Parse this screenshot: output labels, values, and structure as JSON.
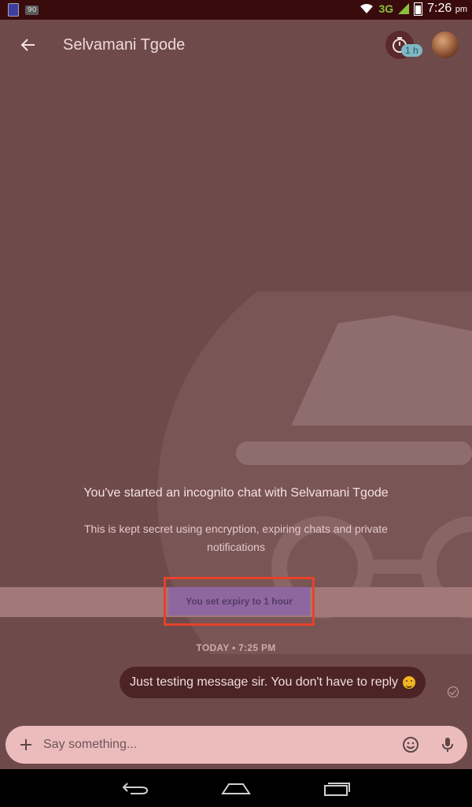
{
  "status_bar": {
    "badge": "90",
    "network": "3G",
    "time": "7:26",
    "ampm": "pm"
  },
  "header": {
    "title": "Selvamani Tgode",
    "timer_badge": "1 h"
  },
  "chat": {
    "intro_title": "You've started an incognito chat with Selvamani Tgode",
    "intro_subtitle": "This is kept secret using encryption, expiring chats and private notifications",
    "expiry_notice": "You set expiry to 1 hour",
    "date_label": "TODAY • 7:25 PM",
    "messages": [
      {
        "text": "Just testing message sir. You don't have to reply",
        "emoji": "smiley"
      }
    ]
  },
  "composer": {
    "placeholder": "Say something..."
  },
  "icons": {
    "back": "back-arrow-icon",
    "timer": "stopwatch-icon",
    "add": "plus-icon",
    "emoji": "emoji-icon",
    "mic": "mic-icon",
    "nav_back": "nav-back-icon",
    "nav_home": "nav-home-icon",
    "nav_recents": "nav-recents-icon"
  },
  "colors": {
    "background": "#6f4a4b",
    "status_bar": "#3a0b0d",
    "bubble": "#4c2426",
    "composer": "#ecbcbd",
    "highlight_border": "#e8412a",
    "expiry_fill": "#8f67a0"
  }
}
